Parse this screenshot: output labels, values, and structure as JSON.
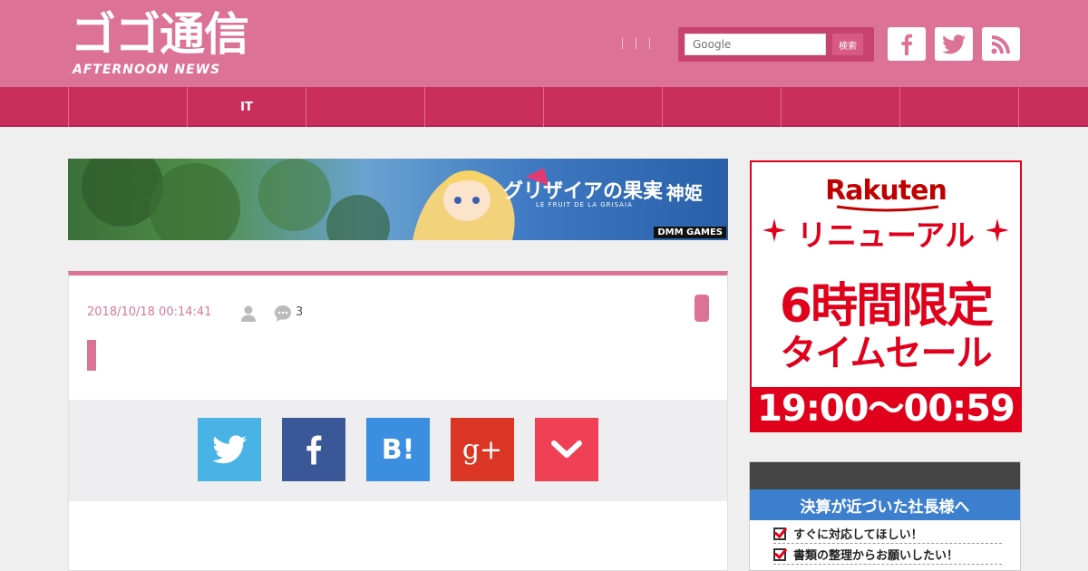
{
  "header": {
    "logo_main": "ゴゴ通信",
    "logo_sub": "AFTERNOON NEWS",
    "search_placeholder": "Google",
    "search_button": "検索",
    "social": [
      "facebook-icon",
      "twitter-icon",
      "rss-icon"
    ]
  },
  "nav": {
    "items": [
      "",
      "IT",
      "",
      "",
      "",
      "",
      "",
      "",
      ""
    ]
  },
  "banner": {
    "title": "グリザイアの果実",
    "collab": "× 神姫",
    "subtitle": "LE FRUIT DE LA GRISAIA",
    "brand": "DMM GAMES"
  },
  "article": {
    "date": "2018/10/18 00:14:41",
    "comment_count": "3",
    "share_buttons": [
      "twitter",
      "facebook",
      "hatena",
      "google-plus",
      "pocket"
    ],
    "hatena_label": "B!",
    "gplus_label": "g+"
  },
  "sidebar": {
    "ad1": {
      "logo": "Rakuten",
      "line1": "リニューアル",
      "line2": "6時間限定",
      "line3": "タイムセール",
      "time": "19:00〜00:59"
    },
    "ad2": {
      "heading": "決算が近づいた社長様へ",
      "items": [
        "すぐに対応してほしい！",
        "書類の整理からお願いしたい！"
      ]
    }
  },
  "colors": {
    "header_pink": "#dc7295",
    "nav_pink": "#c92e5c",
    "twitter": "#4ab3e6",
    "facebook": "#3a5898",
    "hatena": "#3b8ee0",
    "gplus": "#db3526",
    "pocket": "#ef4056",
    "rakuten_red": "#e0001b"
  }
}
